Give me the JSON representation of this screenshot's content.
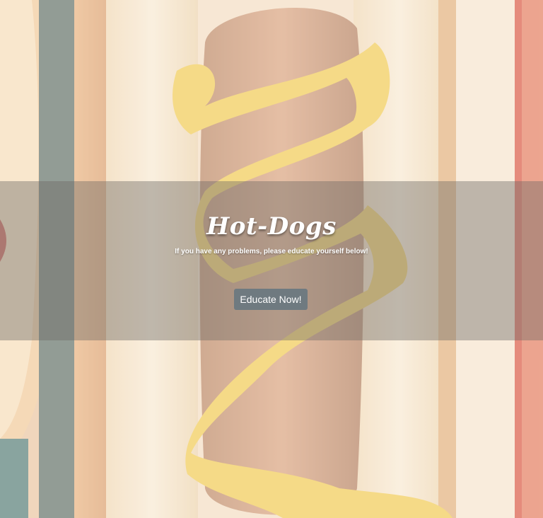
{
  "hero": {
    "title": "Hot-Dogs",
    "subtitle": "If you have any problems, please educate yourself below!",
    "button_label": "Educate Now!",
    "background_image": "hot-dog-with-mustard",
    "overlay_color": "#6e6964"
  },
  "colors": {
    "button": "#6f7a80",
    "text": "#ffffff",
    "mustard": "#f2cc52",
    "sausage": "#c98a5c",
    "bun": "#f4e2c4"
  }
}
